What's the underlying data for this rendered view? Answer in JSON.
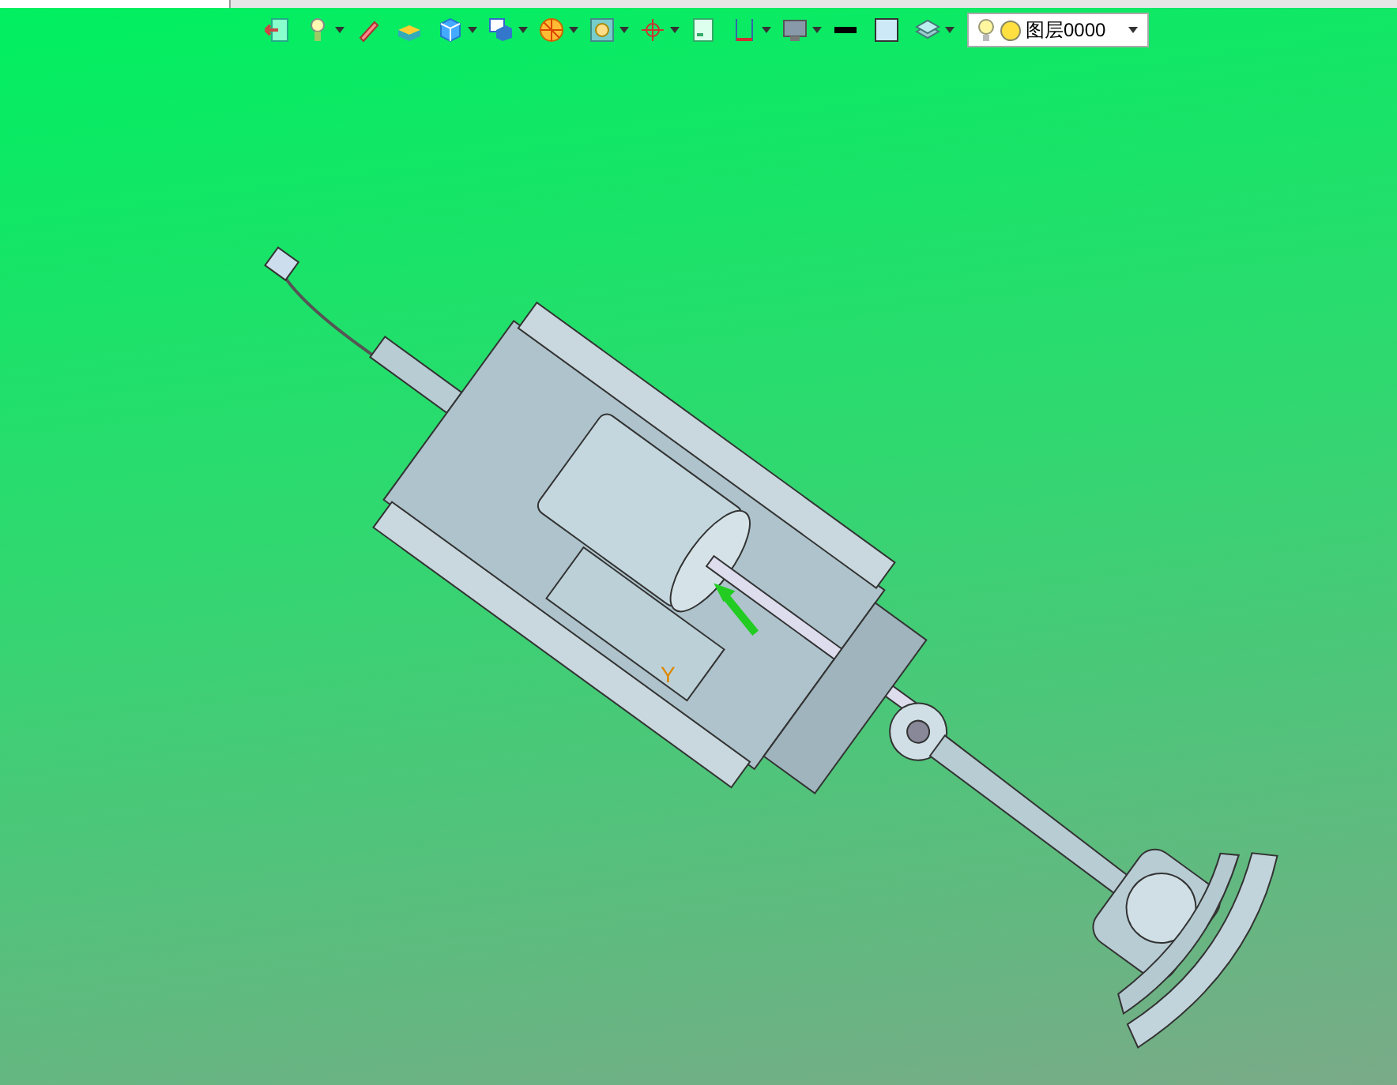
{
  "toolbar": {
    "tools": [
      {
        "kind": "exit",
        "dropdown": false
      },
      {
        "kind": "light",
        "dropdown": true
      },
      {
        "kind": "pencil",
        "dropdown": false
      },
      {
        "kind": "extrude",
        "dropdown": false
      },
      {
        "kind": "cube",
        "dropdown": true
      },
      {
        "kind": "view",
        "dropdown": true
      },
      {
        "kind": "sphere",
        "dropdown": true
      },
      {
        "kind": "render",
        "dropdown": true
      },
      {
        "kind": "axis",
        "dropdown": true
      },
      {
        "kind": "panel",
        "dropdown": false
      },
      {
        "kind": "ruler",
        "dropdown": true
      },
      {
        "kind": "monitor",
        "dropdown": true
      },
      {
        "kind": "line",
        "dropdown": false
      },
      {
        "kind": "fill",
        "dropdown": false
      },
      {
        "kind": "stack",
        "dropdown": true
      }
    ],
    "layer": {
      "name": "图层0000",
      "visible": true
    }
  },
  "viewport": {
    "axis_label": "Y"
  }
}
